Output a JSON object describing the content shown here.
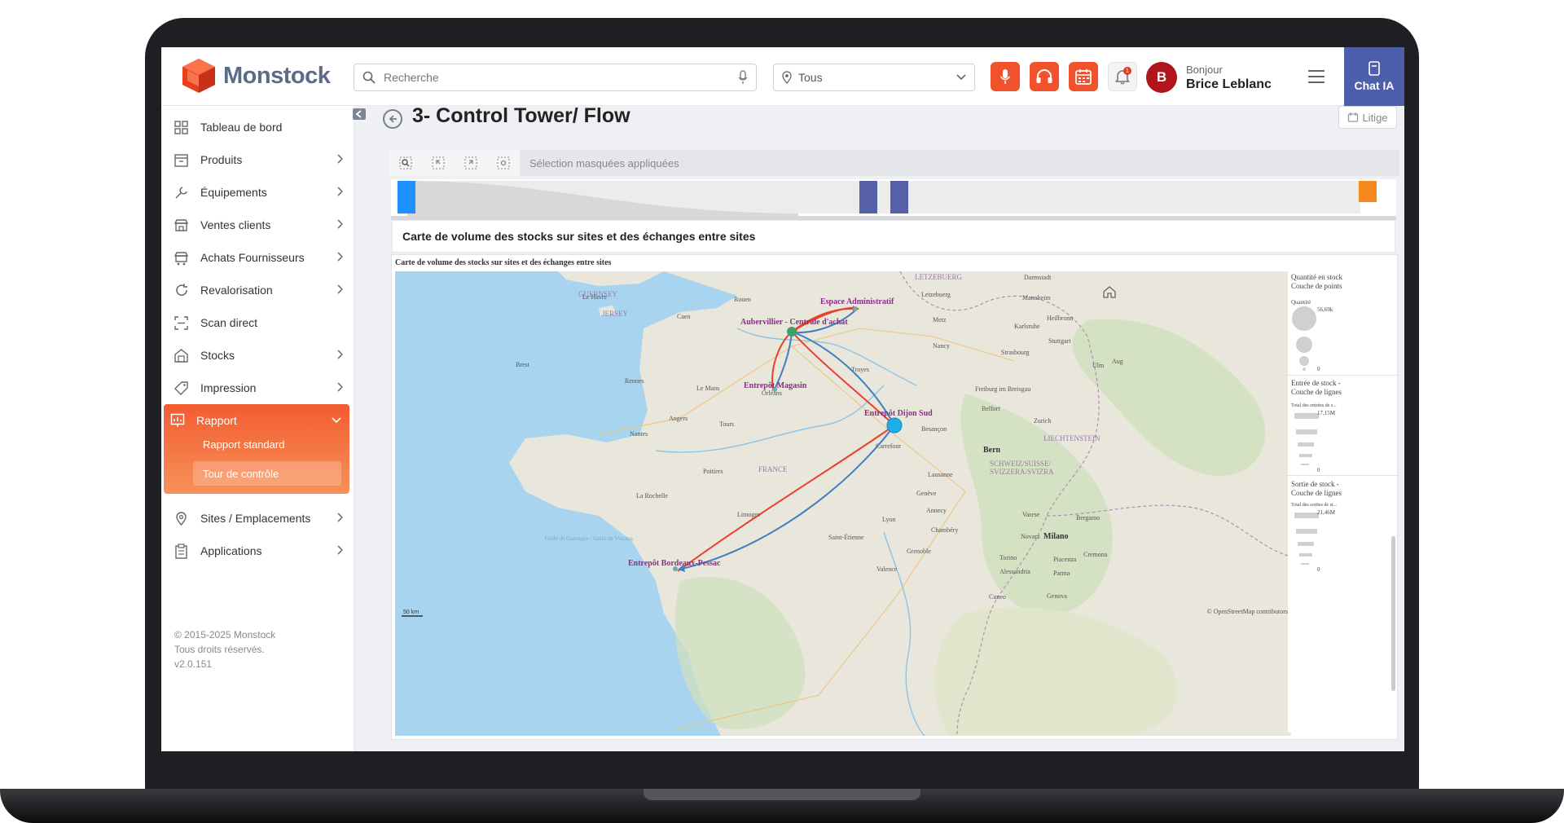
{
  "app": {
    "logo_text": "Monstock"
  },
  "header": {
    "search_placeholder": "Recherche",
    "location_value": "Tous",
    "notification_count": "1",
    "greeting": "Bonjour",
    "user_name": "Brice Leblanc",
    "avatar_initial": "B",
    "chat_label": "Chat IA"
  },
  "sidebar": {
    "items": [
      {
        "label": "Tableau de bord",
        "icon": "grid-icon"
      },
      {
        "label": "Produits",
        "icon": "box-icon"
      },
      {
        "label": "Équipements",
        "icon": "wrench-icon"
      },
      {
        "label": "Ventes clients",
        "icon": "store-icon"
      },
      {
        "label": "Achats Fournisseurs",
        "icon": "cart-icon"
      },
      {
        "label": "Revalorisation",
        "icon": "refresh-icon"
      },
      {
        "label": "Scan direct",
        "icon": "scan-icon"
      },
      {
        "label": "Stocks",
        "icon": "warehouse-icon"
      },
      {
        "label": "Impression",
        "icon": "tag-icon"
      },
      {
        "label": "Rapport",
        "icon": "chart-icon"
      },
      {
        "label": "Sites / Emplacements",
        "icon": "location-icon"
      },
      {
        "label": "Applications",
        "icon": "clipboard-icon"
      }
    ],
    "rapport_sub": [
      "Rapport standard",
      "Tour de contrôle"
    ],
    "copyright": [
      "© 2015-2025 Monstock",
      "Tous droits réservés.",
      "v2.0.151"
    ]
  },
  "main": {
    "title": "3- Control Tower/ Flow",
    "litige_label": "Litige",
    "toolbar_text": "Sélection masquées appliquées",
    "section_title": "Carte de volume des stocks sur sites et des échanges entre sites",
    "map_caption": "Carte de volume des stocks sur sites et des échanges entre sites",
    "map_scale": "50 km",
    "map_attribution": "© OpenStreetMap contributors",
    "places": [
      {
        "name": "GUERNSEY",
        "cls": "country"
      },
      {
        "name": "JERSEY",
        "cls": "country"
      },
      {
        "name": "LETZEBUERG",
        "cls": "country"
      },
      {
        "name": "Letzebuerg",
        "cls": "city"
      },
      {
        "name": "Darmstadt",
        "cls": "city"
      },
      {
        "name": "Le Havre",
        "cls": "city"
      },
      {
        "name": "Rouen",
        "cls": "city"
      },
      {
        "name": "Caen",
        "cls": "city"
      },
      {
        "name": "Mannheim",
        "cls": "city"
      },
      {
        "name": "Metz",
        "cls": "city"
      },
      {
        "name": "Karlsruhe",
        "cls": "city"
      },
      {
        "name": "Heilbronn",
        "cls": "city"
      },
      {
        "name": "Stuttgart",
        "cls": "city"
      },
      {
        "name": "Nancy",
        "cls": "city"
      },
      {
        "name": "Strasbourg",
        "cls": "city"
      },
      {
        "name": "Ulm",
        "cls": "city"
      },
      {
        "name": "Aug",
        "cls": "city"
      },
      {
        "name": "Brest",
        "cls": "city"
      },
      {
        "name": "Rennes",
        "cls": "city"
      },
      {
        "name": "Le Mans",
        "cls": "city"
      },
      {
        "name": "Troyes",
        "cls": "city"
      },
      {
        "name": "Freiburg im Breisgau",
        "cls": "city"
      },
      {
        "name": "Angers",
        "cls": "city"
      },
      {
        "name": "Tours",
        "cls": "city"
      },
      {
        "name": "Belfort",
        "cls": "city"
      },
      {
        "name": "Zurich",
        "cls": "city"
      },
      {
        "name": "Nantes",
        "cls": "city"
      },
      {
        "name": "Besançon",
        "cls": "city"
      },
      {
        "name": "LIECHTENSTEIN",
        "cls": "country"
      },
      {
        "name": "Bern",
        "cls": "bigcity"
      },
      {
        "name": "SCHWEIZ/SUISSE/",
        "cls": "country"
      },
      {
        "name": "SVIZZERA/SVIZRA",
        "cls": "country"
      },
      {
        "name": "FRANCE",
        "cls": "country"
      },
      {
        "name": "Poitiers",
        "cls": "city"
      },
      {
        "name": "Lausanne",
        "cls": "city"
      },
      {
        "name": "La Rochelle",
        "cls": "city"
      },
      {
        "name": "Genève",
        "cls": "city"
      },
      {
        "name": "Annecy",
        "cls": "city"
      },
      {
        "name": "Limoges",
        "cls": "city"
      },
      {
        "name": "Varese",
        "cls": "city"
      },
      {
        "name": "Bergamo",
        "cls": "city"
      },
      {
        "name": "Lyon",
        "cls": "city"
      },
      {
        "name": "Chambéry",
        "cls": "city"
      },
      {
        "name": "Novara",
        "cls": "city"
      },
      {
        "name": "Milano",
        "cls": "bigcity"
      },
      {
        "name": "Saint-Étienne",
        "cls": "city"
      },
      {
        "name": "Grenoble",
        "cls": "city"
      },
      {
        "name": "Torino",
        "cls": "city"
      },
      {
        "name": "Piacenza",
        "cls": "city"
      },
      {
        "name": "Cremona",
        "cls": "city"
      },
      {
        "name": "Alessandria",
        "cls": "city"
      },
      {
        "name": "Parma",
        "cls": "city"
      },
      {
        "name": "Valence",
        "cls": "city"
      },
      {
        "name": "Cuneo",
        "cls": "city"
      },
      {
        "name": "Genova",
        "cls": "city"
      },
      {
        "name": "Carrefour",
        "cls": "city"
      },
      {
        "name": "Orléans",
        "cls": "city"
      },
      {
        "name": "Golfe de Gascogne / Golfo de Vizcaya",
        "cls": "sea"
      }
    ],
    "sites": [
      {
        "name": "Espace Administratif"
      },
      {
        "name": "Aubervillier - Centrale d'achat"
      },
      {
        "name": "Entrepôt Magasin"
      },
      {
        "name": "Entrepôt Dijon Sud"
      },
      {
        "name": "Entrepôt Bordeaux-Pessac"
      }
    ],
    "legend": {
      "stock_title": [
        "Quantité en stock",
        "Couche de points"
      ],
      "stock_sub": "Quantité",
      "stock_max": "56,69k",
      "stock_min": "0",
      "entry_title": [
        "Entrée de stock -",
        "Couche de lignes"
      ],
      "entry_sub": "Total des entrées de s...",
      "entry_max": "17,15M",
      "entry_min": "0",
      "exit_title": [
        "Sortie de stock -",
        "Couche de lignes"
      ],
      "exit_sub": "Total des sorties de st...",
      "exit_max": "21,46M",
      "exit_min": "0"
    }
  }
}
